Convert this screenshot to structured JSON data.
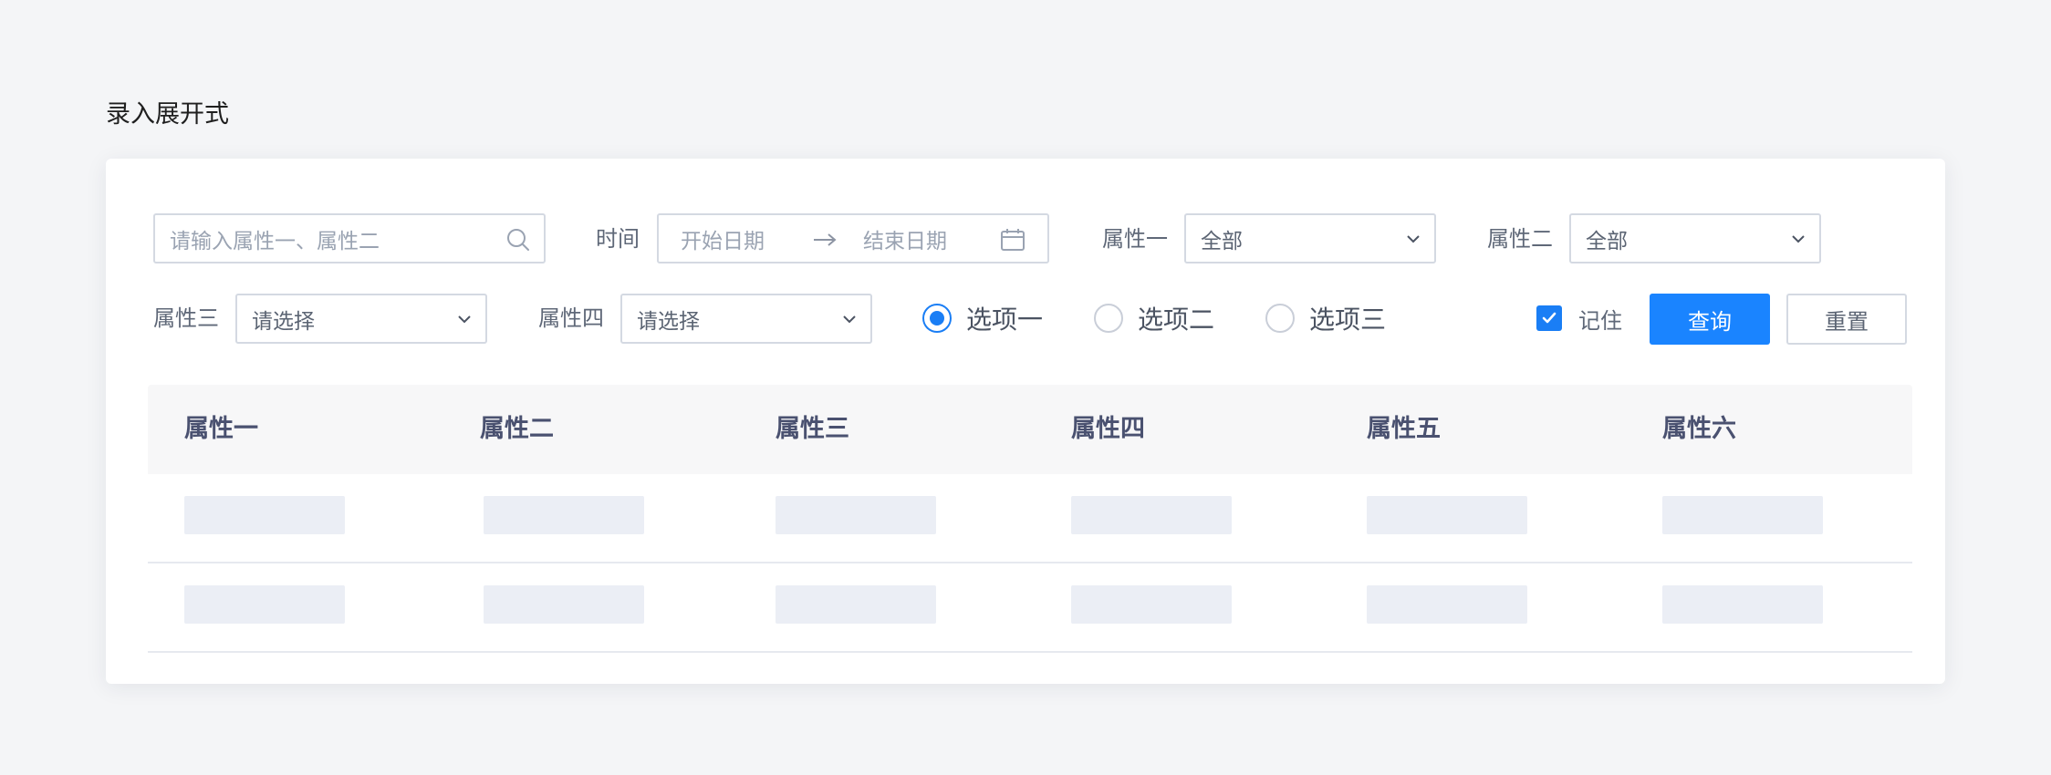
{
  "page": {
    "title": "录入展开式"
  },
  "filters": {
    "search": {
      "placeholder": "请输入属性一、属性二"
    },
    "time": {
      "label": "时间",
      "start_placeholder": "开始日期",
      "end_placeholder": "结束日期"
    },
    "attr1": {
      "label": "属性一",
      "value": "全部"
    },
    "attr2": {
      "label": "属性二",
      "value": "全部"
    },
    "attr3": {
      "label": "属性三",
      "placeholder": "请选择"
    },
    "attr4": {
      "label": "属性四",
      "placeholder": "请选择"
    },
    "radios": [
      {
        "label": "选项一",
        "selected": true
      },
      {
        "label": "选项二",
        "selected": false
      },
      {
        "label": "选项三",
        "selected": false
      }
    ],
    "remember": {
      "label": "记住",
      "checked": true
    },
    "query_label": "查询",
    "reset_label": "重置"
  },
  "table": {
    "columns": [
      "属性一",
      "属性二",
      "属性三",
      "属性四",
      "属性五",
      "属性六"
    ],
    "row_count": 2
  },
  "colors": {
    "primary": "#1a84ff",
    "skeleton": "#ebeef5",
    "header_bg": "#f7f7f8"
  }
}
